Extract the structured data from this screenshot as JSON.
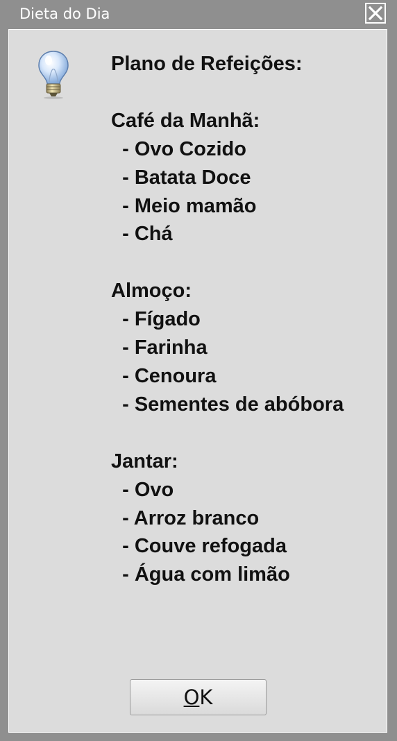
{
  "window": {
    "title": "Dieta do Dia",
    "close_icon": "close-icon"
  },
  "dialog": {
    "icon": "lightbulb-icon",
    "message": {
      "heading": "Plano de Refeições:",
      "sections": [
        {
          "title": "Café da Manhã:",
          "items": [
            "- Ovo Cozido",
            "- Batata Doce",
            "- Meio mamão",
            "- Chá"
          ]
        },
        {
          "title": "Almoço:",
          "items": [
            "- Fígado",
            "- Farinha",
            "- Cenoura",
            "- Sementes de abóbora"
          ]
        },
        {
          "title": "Jantar:",
          "items": [
            "- Ovo",
            "- Arroz branco",
            "- Couve refogada",
            "- Água com limão"
          ]
        }
      ]
    },
    "ok_button": {
      "mnemonic": "O",
      "rest": "K"
    }
  },
  "colors": {
    "frame": "#8f8f8f",
    "dialog_bg": "#dcdcdc",
    "text": "#111111"
  }
}
